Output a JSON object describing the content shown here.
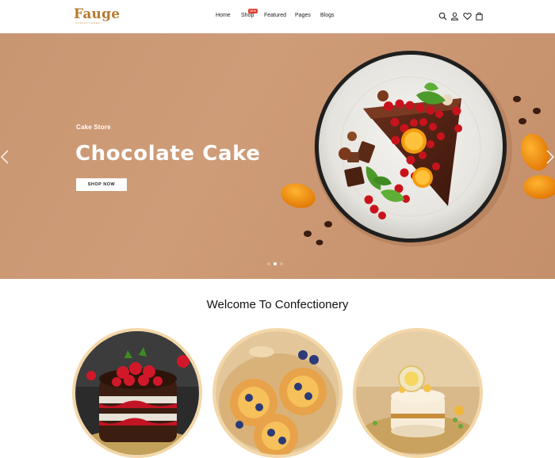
{
  "brand": {
    "name": "Fauge",
    "tagline": "CONFECTIONERY"
  },
  "nav": {
    "items": [
      "Home",
      "Shop",
      "Featured",
      "Pages",
      "Blogs"
    ],
    "badge": "NEW"
  },
  "header_icons": [
    "search-icon",
    "user-icon",
    "heart-icon",
    "bag-icon"
  ],
  "hero": {
    "subtitle": "Cake Store",
    "title": "Chocolate Cake",
    "button": "SHOP NOW",
    "slide_count": 3,
    "active_slide": 2
  },
  "welcome": {
    "title": "Welcome To Confectionery"
  },
  "categories": [
    "cake-image",
    "pastry-image",
    "dessert-image"
  ],
  "colors": {
    "brand": "#b8792f",
    "hero_bg": "#c99672",
    "badge": "#e33d2d",
    "circle_border": "#f3d7a8"
  }
}
